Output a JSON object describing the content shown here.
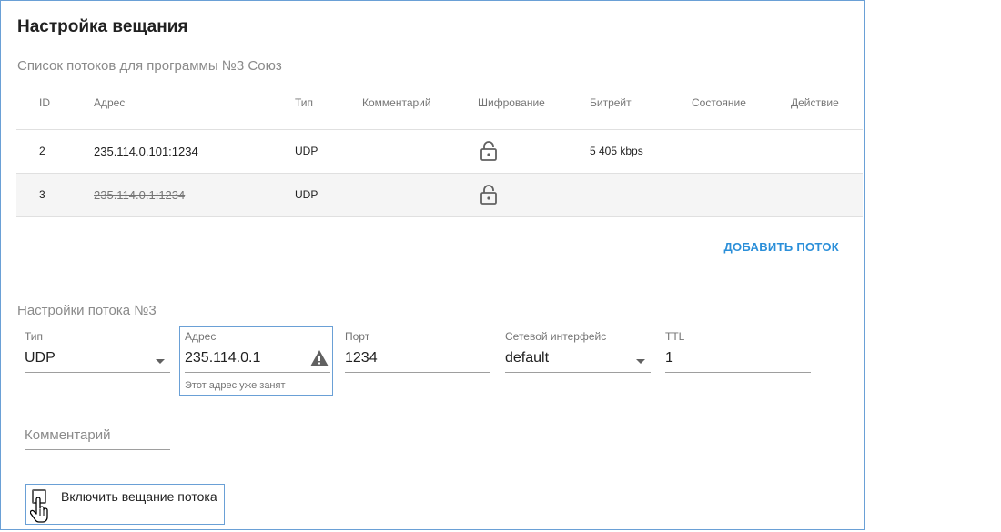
{
  "header": {
    "title": "Настройка вещания"
  },
  "streams": {
    "heading": "Список потоков для программы №3 Союз",
    "columns": {
      "id": "ID",
      "address": "Адрес",
      "type": "Тип",
      "comment": "Комментарий",
      "encryption": "Шифрование",
      "bitrate": "Битрейт",
      "state": "Состояние",
      "action": "Действие"
    },
    "rows": [
      {
        "id": "2",
        "address": "235.114.0.101:1234",
        "type": "UDP",
        "comment": "",
        "encryption_icon": "lock-open-icon",
        "bitrate": "5 405 kbps",
        "state": "",
        "action": ""
      },
      {
        "id": "3",
        "address": "235.114.0.1:1234",
        "type": "UDP",
        "comment": "",
        "encryption_icon": "lock-open-icon",
        "bitrate": "",
        "state": "",
        "action": ""
      }
    ],
    "add_button": "ДОБАВИТЬ ПОТОК"
  },
  "stream_settings": {
    "heading": "Настройки потока №3",
    "type": {
      "label": "Тип",
      "value": "UDP"
    },
    "address": {
      "label": "Адрес",
      "value": "235.114.0.1",
      "helper": "Этот адрес уже занят"
    },
    "port": {
      "label": "Порт",
      "value": "1234"
    },
    "interface": {
      "label": "Сетевой интерфейс",
      "value": "default"
    },
    "ttl": {
      "label": "TTL",
      "value": "1"
    },
    "comment": {
      "placeholder": "Комментарий"
    },
    "enable": {
      "label": "Включить вещание потока",
      "checked": false
    }
  },
  "colors": {
    "accent": "#2b8fd9",
    "focus_border": "#6aa0d6",
    "row_alt": "#f5f5f5"
  }
}
